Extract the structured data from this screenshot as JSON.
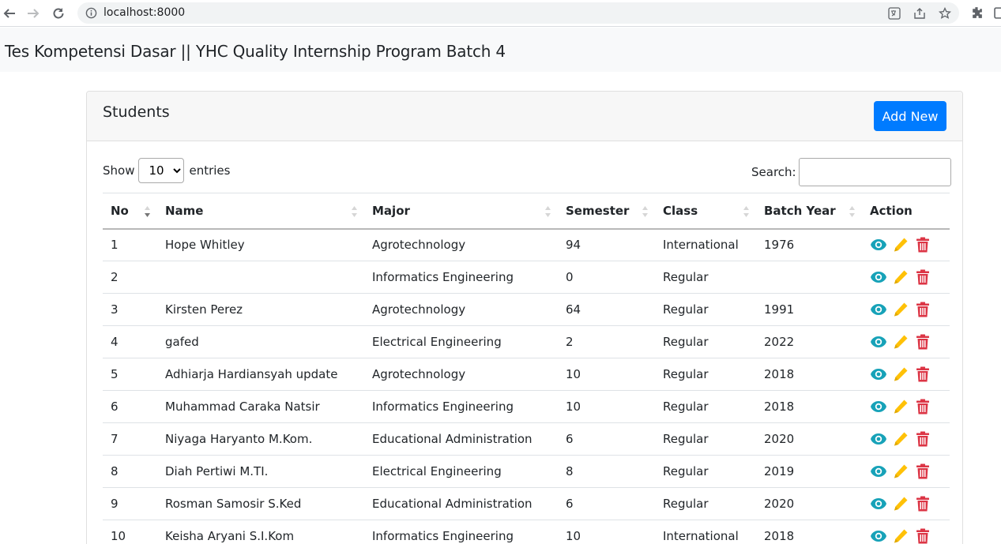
{
  "browser": {
    "url": "localhost:8000"
  },
  "page": {
    "title": "Tes Kompetensi Dasar || YHC Quality Internship Program Batch 4"
  },
  "card": {
    "title": "Students",
    "add_button": "Add New"
  },
  "controls": {
    "show_label": "Show",
    "entries_value": "10",
    "entries_label": "entries",
    "search_label": "Search:",
    "search_value": ""
  },
  "table": {
    "columns": [
      "No",
      "Name",
      "Major",
      "Semester",
      "Class",
      "Batch Year",
      "Action"
    ],
    "rows": [
      {
        "no": "1",
        "name": "Hope Whitley",
        "major": "Agrotechnology",
        "semester": "94",
        "class": "International",
        "year": "1976"
      },
      {
        "no": "2",
        "name": "",
        "major": "Informatics Engineering",
        "semester": "0",
        "class": "Regular",
        "year": ""
      },
      {
        "no": "3",
        "name": "Kirsten Perez",
        "major": "Agrotechnology",
        "semester": "64",
        "class": "Regular",
        "year": "1991"
      },
      {
        "no": "4",
        "name": "gafed",
        "major": "Electrical Engineering",
        "semester": "2",
        "class": "Regular",
        "year": "2022"
      },
      {
        "no": "5",
        "name": "Adhiarja Hardiansyah update",
        "major": "Agrotechnology",
        "semester": "10",
        "class": "Regular",
        "year": "2018"
      },
      {
        "no": "6",
        "name": "Muhammad Caraka Natsir",
        "major": "Informatics Engineering",
        "semester": "10",
        "class": "Regular",
        "year": "2018"
      },
      {
        "no": "7",
        "name": "Niyaga Haryanto M.Kom.",
        "major": "Educational Administration",
        "semester": "6",
        "class": "Regular",
        "year": "2020"
      },
      {
        "no": "8",
        "name": "Diah Pertiwi M.TI.",
        "major": "Electrical Engineering",
        "semester": "8",
        "class": "Regular",
        "year": "2019"
      },
      {
        "no": "9",
        "name": "Rosman Samosir S.Ked",
        "major": "Educational Administration",
        "semester": "6",
        "class": "Regular",
        "year": "2020"
      },
      {
        "no": "10",
        "name": "Keisha Aryani S.I.Kom",
        "major": "Informatics Engineering",
        "semester": "10",
        "class": "International",
        "year": "2018"
      }
    ]
  },
  "colors": {
    "primary": "#007bff",
    "view_icon": "#17a2b8",
    "edit_icon": "#ffc107",
    "delete_icon": "#dc3545"
  },
  "icons": [
    "back-icon",
    "forward-icon",
    "reload-icon",
    "info-icon",
    "translate-icon",
    "share-icon",
    "star-icon",
    "extensions-icon",
    "eye-icon",
    "pencil-icon",
    "trash-icon"
  ]
}
